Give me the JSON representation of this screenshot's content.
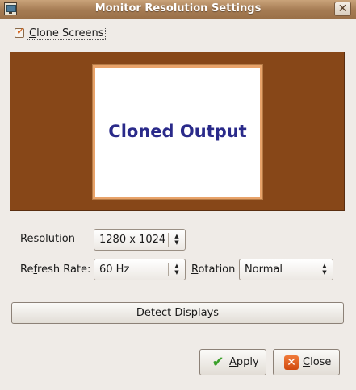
{
  "window": {
    "title": "Monitor Resolution Settings",
    "close_glyph": "✕",
    "icon": "monitor-settings-icon"
  },
  "clone": {
    "checked": true,
    "label_first": "C",
    "label_rest": "lone Screens"
  },
  "display": {
    "monitor_label": "Cloned Output"
  },
  "resolution": {
    "label_u": "R",
    "label_rest": "esolution",
    "value": "1280 x 1024"
  },
  "refresh": {
    "label_pre": "Re",
    "label_u": "f",
    "label_rest": "resh Rate:",
    "value": "60 Hz"
  },
  "rotation": {
    "label_u": "R",
    "label_rest": "otation",
    "value": "Normal"
  },
  "buttons": {
    "detect_u": "D",
    "detect_rest": "etect Displays",
    "apply_u": "A",
    "apply_rest": "pply",
    "close_u": "C",
    "close_rest": "lose"
  },
  "colors": {
    "titlebar": "#a57b53",
    "display_background": "#874718",
    "monitor_border": "#e8a36a",
    "monitor_text": "#2a2a8a",
    "accent": "#d45a10"
  }
}
